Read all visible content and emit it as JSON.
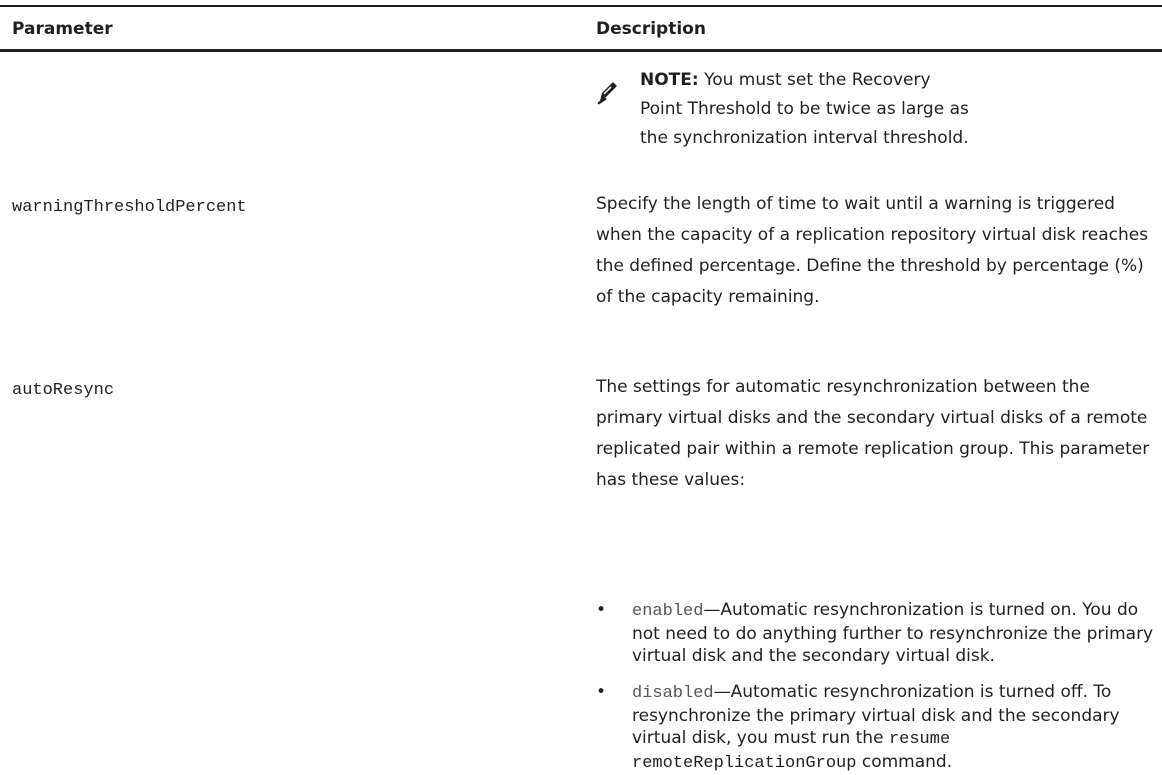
{
  "table": {
    "headers": {
      "parameter": "Parameter",
      "description": "Description"
    },
    "note": {
      "label": "NOTE:",
      "text": " You must set the Recovery Point Threshold to be twice as large as the synchronization interval threshold."
    },
    "rows": [
      {
        "parameter": "warningThresholdPercent",
        "description": "Specify the length of time to wait until a warning is triggered when the capacity of a replication repository virtual disk reaches the defined percentage. Define the threshold by percentage (%) of the capacity remaining."
      },
      {
        "parameter": "autoResync",
        "description": "The settings for automatic resynchronization between the primary virtual disks and the secondary virtual disks of a remote replicated pair within a remote replication group. This parameter has these values:"
      }
    ],
    "values": [
      {
        "keyword": "enabled",
        "text": "—Automatic resynchronization is turned on. You do not need to do anything further to resynchronize the primary virtual disk and the secondary virtual disk."
      },
      {
        "keyword": "disabled",
        "text": "—Automatic resynchronization is turned off. To resynchronize the primary virtual disk and the secondary virtual disk, you must run the ",
        "command": "resume remoteReplicationGroup",
        "text_after": " command."
      }
    ],
    "bullet": "•"
  },
  "icons": {
    "note": "pencil-note-icon"
  }
}
